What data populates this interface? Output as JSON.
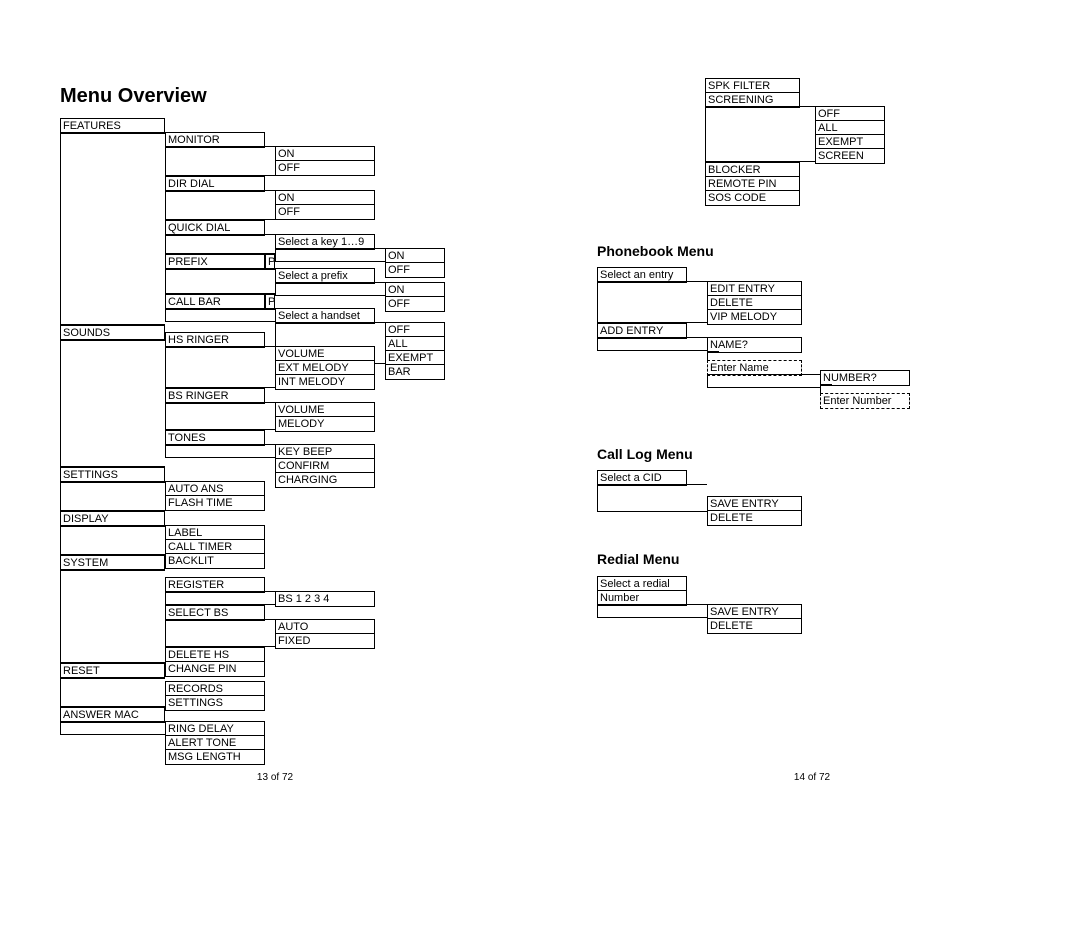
{
  "title": "Menu Overview",
  "left": {
    "col0": {
      "features": "FEATURES",
      "sounds": "SOUNDS",
      "settings": "SETTINGS",
      "display": "DISPLAY",
      "system": "SYSTEM",
      "reset": "RESET",
      "answer_mac": "ANSWER MAC"
    },
    "col1": {
      "monitor": "MONITOR",
      "dir_dial": "DIR DIAL",
      "quick_dial": "QUICK DIAL",
      "prefix": "PREFIX",
      "prefix_p": "P",
      "call_bar": "CALL BAR",
      "call_bar_p": "P",
      "hs_ringer": "HS RINGER",
      "bs_ringer": "BS RINGER",
      "tones": "TONES",
      "auto_ans": "AUTO ANS",
      "flash_time": "FLASH TIME",
      "label": "LABEL",
      "call_timer": "CALL TIMER",
      "backlit": "BACKLIT",
      "register": "REGISTER",
      "select_bs": "SELECT BS",
      "delete_hs": "DELETE HS",
      "change_pin": "CHANGE PIN",
      "records": "RECORDS",
      "settings": "SETTINGS",
      "ring_delay": "RING DELAY",
      "alert_tone": "ALERT TONE",
      "msg_length": "MSG LENGTH"
    },
    "col2": {
      "on1": "ON",
      "off1": "OFF",
      "on2": "ON",
      "off2": "OFF",
      "select_key": "Select a key 1…9",
      "select_prefix": "Select a prefix",
      "select_handset": "Select a handset",
      "volume1": "VOLUME",
      "ext_melody": "EXT MELODY",
      "int_melody": "INT MELODY",
      "volume2": "VOLUME",
      "melody": "MELODY",
      "key_beep": "KEY BEEP",
      "confirm": "CONFIRM",
      "charging": "CHARGING",
      "bs1234": "BS 1 2 3 4",
      "auto": "AUTO",
      "fixed": "FIXED"
    },
    "col3": {
      "on1": "ON",
      "off1": "OFF",
      "on2": "ON",
      "off2": "OFF",
      "off3": "OFF",
      "all": "ALL",
      "exempt": "EXEMPT",
      "bar": "BAR"
    }
  },
  "right": {
    "top": {
      "spk_filter": "SPK FILTER",
      "screening": "SCREENING",
      "off": "OFF",
      "all": "ALL",
      "exempt": "EXEMPT",
      "screen": "SCREEN",
      "blocker": "BLOCKER",
      "remote_pin": "REMOTE PIN",
      "sos_code": "SOS CODE"
    },
    "phonebook": {
      "title": "Phonebook Menu",
      "select_entry": "Select an entry",
      "edit_entry": "EDIT ENTRY",
      "delete": "DELETE",
      "vip_melody": "VIP MELODY",
      "add_entry": "ADD ENTRY",
      "name_q": "NAME?",
      "enter_name": "Enter Name",
      "number_q": "NUMBER?",
      "enter_number": "Enter Number"
    },
    "calllog": {
      "title": "Call Log Menu",
      "select_cid": "Select a CID",
      "save_entry": "SAVE ENTRY",
      "delete": "DELETE"
    },
    "redial": {
      "title": "Redial Menu",
      "select_redial1": "Select a redial",
      "select_redial2": "Number",
      "save_entry": "SAVE ENTRY",
      "delete": "DELETE"
    }
  },
  "footer_left": "13 of 72",
  "footer_right": "14 of 72"
}
